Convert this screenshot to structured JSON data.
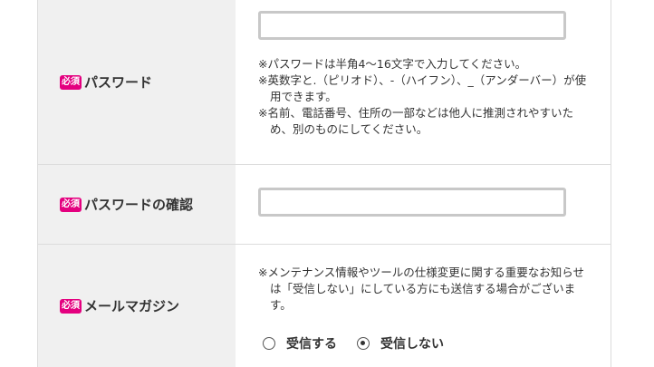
{
  "form": {
    "required_badge": "必須",
    "password": {
      "label": "パスワード",
      "value": "",
      "notes": [
        "※パスワードは半角4～16文字で入力してください。",
        "※英数字と.（ピリオド）、-（ハイフン）、_（アンダーバー）が使用できます。",
        "※名前、電話番号、住所の一部などは他人に推測されやすいため、別のものにしてください。"
      ]
    },
    "password_confirm": {
      "label": "パスワードの確認",
      "value": ""
    },
    "mail_magazine": {
      "label": "メールマガジン",
      "note": "※メンテナンス情報やツールの仕様変更に関する重要なお知らせは「受信しない」にしている方にも送信する場合がございます。",
      "options": [
        "受信する",
        "受信しない"
      ],
      "selected": "受信しない"
    }
  }
}
